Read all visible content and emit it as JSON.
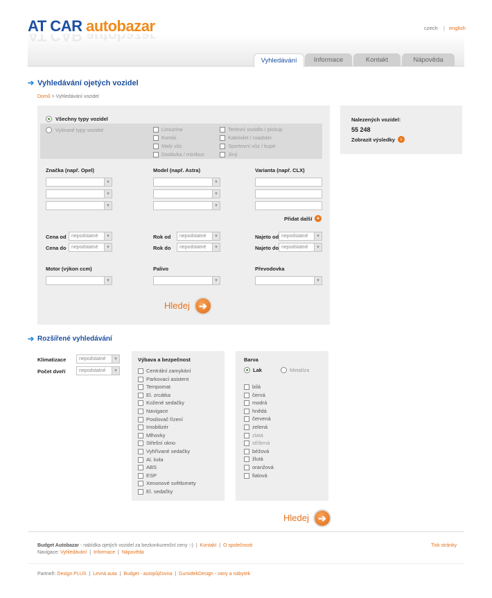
{
  "header": {
    "logo_part1": "AT CAR",
    "logo_part2": "autobazar",
    "lang_czech": "czech",
    "lang_sep": "|",
    "lang_english": "english"
  },
  "tabs": [
    {
      "label": "Vyhledávání"
    },
    {
      "label": "Informace"
    },
    {
      "label": "Kontakt"
    },
    {
      "label": "Nápověda"
    }
  ],
  "page": {
    "title": "Vyhledávání ojetých vozidel",
    "breadcrumb_home": "Domů",
    "breadcrumb_rest": "> Vyhledávání vozidel"
  },
  "vehicle_types": {
    "all": "Všechny typy vozidel",
    "selected": "Vybrané typy vozidel",
    "types": [
      "Limuzína",
      "Kombi",
      "Malý vůz",
      "Dodávka / minibus",
      "Terénní vozidlo / pickup",
      "Kabriolet / roadster",
      "Sportovní vůz / kupé",
      "Jiný"
    ]
  },
  "fields": {
    "brand": "Značka (např. Opel)",
    "model": "Model (např. Astra)",
    "variant": "Varianta (např. CLX)",
    "add_more": "Přidat další",
    "price_from": "Cena od",
    "price_to": "Cena do",
    "year_from": "Rok od",
    "year_to": "Rok do",
    "km_from": "Najeto od",
    "km_to": "Najeto do",
    "unimportant": "nepodstatné",
    "engine": "Motor (výkon ccm)",
    "fuel": "Palivo",
    "gearbox": "Převodovka",
    "search": "Hledej"
  },
  "results": {
    "label": "Nalezených vozidel:",
    "count": "55 248",
    "show": "Zobrazit výsledky"
  },
  "advanced": {
    "title": "Rozšířené vyhledávání",
    "aircon": "Klimatizace",
    "doors": "Počet dveří",
    "unimportant": "nepodstatné",
    "equipment_title": "Výbava a bezpečnost",
    "equipment": [
      "Centrální zamykání",
      "Parkovací asistent",
      "Tempomat",
      "El. zrcátka",
      "Kožené sedačky",
      "Navigace",
      "Posilovač řízení",
      "Imobilizér",
      "Mlhovky",
      "Střešní okno",
      "Vyhřívané sedačky",
      "Al. kola",
      "ABS",
      "ESP",
      "Xenonové světlomety",
      "El. sedačky"
    ],
    "color_title": "Barva",
    "paint": "Lak",
    "metallic": "Metalíza",
    "colors": [
      {
        "name": "bílá",
        "muted": false
      },
      {
        "name": "černá",
        "muted": false
      },
      {
        "name": "modrá",
        "muted": false
      },
      {
        "name": "hnědá",
        "muted": false
      },
      {
        "name": "červená",
        "muted": false
      },
      {
        "name": "zelená",
        "muted": false
      },
      {
        "name": "zlatá",
        "muted": true
      },
      {
        "name": "stříbrná",
        "muted": true
      },
      {
        "name": "béžová",
        "muted": false
      },
      {
        "name": "žlutá",
        "muted": false
      },
      {
        "name": "oranžová",
        "muted": false
      },
      {
        "name": "fialová",
        "muted": false
      }
    ],
    "search": "Hledej"
  },
  "footer": {
    "brand": "Budget Autobazar",
    "tagline": " - nabídka ojetých vozidel za bezkonkurenční ceny :-)",
    "sep": "|",
    "contact": "Kontakt",
    "about": "O společnosti",
    "nav_label": "Navigace:",
    "nav": [
      "Vyhledávání",
      "Informace",
      "Nápověda"
    ],
    "print": "Tisk stránky",
    "partners_label": "Partneři:",
    "partners": [
      "Design PLUS",
      "Levná auta",
      "Budget - autopůjčovna",
      "GumidekDesign - vany a nábytek"
    ]
  },
  "colors": {
    "brand_blue": "#1c4fa0",
    "accent_orange": "#e3711b",
    "panel_grey": "#eeeeee"
  }
}
